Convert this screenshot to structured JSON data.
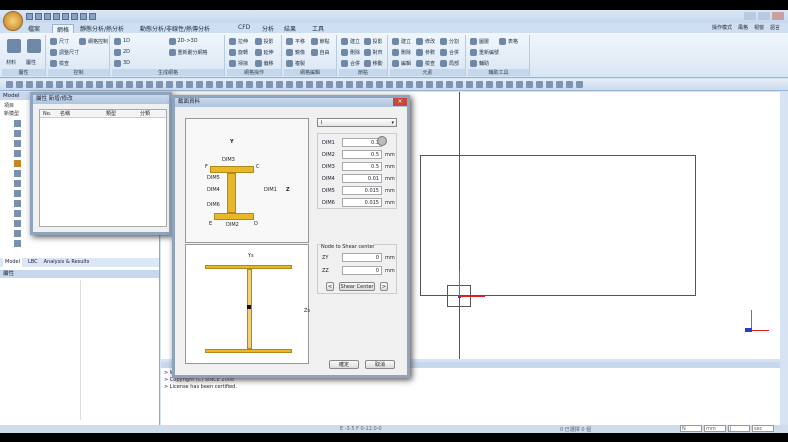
{
  "quick_access_icons": [
    "new-icon",
    "open-icon",
    "folder-icon",
    "save-icon",
    "save-as-icon",
    "import-icon",
    "undo-icon",
    "redo-icon"
  ],
  "tabs": [
    "檔案",
    "網格",
    "靜態分析/熱分析",
    "動態分析/非線性/熱傳分析",
    "CFD",
    "分析",
    "結果",
    "工具"
  ],
  "ribbon_groups": [
    {
      "label": "屬性",
      "items": [
        "材料",
        "屬性"
      ]
    },
    {
      "label": "控制",
      "items": [
        "尺寸",
        "調整尺寸",
        "檢查",
        "網格控制"
      ]
    },
    {
      "label": "生成網格",
      "items": [
        "1D",
        "2D",
        "3D",
        "2D->3D",
        "重新劃分網格"
      ]
    },
    {
      "label": "網格操作",
      "items": [
        "拉伸",
        "旋轉",
        "掃掠",
        "投影",
        "延伸",
        "偏移"
      ]
    },
    {
      "label": "網格編輯",
      "items": [
        "平移",
        "鏡像",
        "複製",
        "節點",
        "自由"
      ]
    },
    {
      "label": "節點",
      "items": [
        "建立",
        "刪除",
        "合併",
        "投影",
        "對齊",
        "移動"
      ]
    },
    {
      "label": "元素",
      "items": [
        "建立",
        "刪除",
        "編輯",
        "修改",
        "參數",
        "檢查",
        "分割",
        "合併",
        "局部"
      ]
    },
    {
      "label": "輔助工具",
      "items": [
        "圖層",
        "重新編號",
        "輔助",
        "表格"
      ]
    }
  ],
  "top_right_menu": [
    "操作模式",
    "風格",
    "視窗",
    "語言"
  ],
  "left_panel": {
    "title": "Model",
    "tree_header": "項目",
    "tree_root": "新模型",
    "tabs": [
      "Model",
      "LBC",
      "Analysis & Results"
    ],
    "property_title": "屬性"
  },
  "property_dialog": {
    "title": "屬性 新增/修改",
    "columns": [
      "No.",
      "名稱",
      "類型",
      "分類"
    ]
  },
  "section_dialog": {
    "title": "截面資料",
    "shape_select": "I",
    "diagram_labels": {
      "y": "Y",
      "z": "Z",
      "dims": [
        "DIM1",
        "DIM2",
        "DIM3",
        "DIM4",
        "DIM5",
        "DIM6"
      ],
      "corners": [
        "F",
        "C",
        "E",
        "D"
      ]
    },
    "dims": [
      {
        "label": "DIM1",
        "value": "0.3",
        "unit": ""
      },
      {
        "label": "DIM2",
        "value": "0.5",
        "unit": "mm"
      },
      {
        "label": "DIM3",
        "value": "0.5",
        "unit": "mm"
      },
      {
        "label": "DIM4",
        "value": "0.01",
        "unit": "mm"
      },
      {
        "label": "DIM5",
        "value": "0.015",
        "unit": "mm"
      },
      {
        "label": "DIM6",
        "value": "0.015",
        "unit": "mm"
      }
    ],
    "shear_center": {
      "title": "Node to Shear center",
      "rows": [
        {
          "label": "ZY",
          "value": "0",
          "unit": "mm"
        },
        {
          "label": "ZZ",
          "value": "0",
          "unit": "mm"
        }
      ],
      "button": "Shear Center",
      "prev": "<",
      "next": ">"
    },
    "preview_labels": {
      "ys": "Ys",
      "zs": "Zs"
    },
    "ok": "確定",
    "cancel": "取消"
  },
  "messages": [
    "> Welcome to midas NFX",
    "> Copyright (C) SINCE 2008",
    "> License has been certified."
  ],
  "status": {
    "coords": "E -3.5 F 0-12.0-0",
    "units_text": "0 已選擇 0 個",
    "units": [
      "N",
      "mm",
      "J",
      "sec"
    ]
  },
  "colors": {
    "accent": "#c5d7ee",
    "section": "#e8b82a",
    "axis_x": "#e02020",
    "axis_y": "#20b030",
    "axis_z": "#2040d0"
  }
}
